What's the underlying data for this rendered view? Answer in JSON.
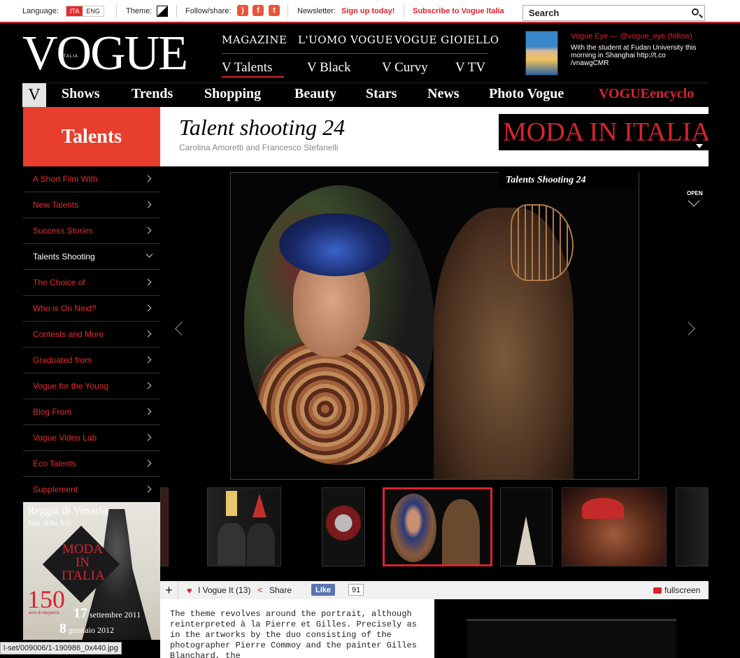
{
  "topbar": {
    "language_label": "Language:",
    "lang_ita": "ITA",
    "lang_eng": "ENG",
    "theme_label": "Theme:",
    "follow_label": "Follow/share:",
    "newsletter_label": "Newsletter:",
    "signup": "Sign up today!",
    "subscribe": "Subscribe to Vogue Italia",
    "search_placeholder": "Search",
    "social_icons": [
      "rss-icon",
      "facebook-icon",
      "twitter-icon"
    ]
  },
  "logo": {
    "text": "VOGUE",
    "sub": "ITALIA"
  },
  "topnav": {
    "row1": [
      "MAGAZINE",
      "L'UOMO VOGUE",
      "VOGUE GIOIELLO"
    ],
    "row2": [
      "V Talents",
      "V Black",
      "V Curvy",
      "V TV"
    ],
    "active": "V Talents"
  },
  "vogue_eye": {
    "title": "Vogue Eye — @vogue_eye (follow)",
    "text": "With the student at Fudan University this morning in Shanghai http://t.co /vnawgCMR"
  },
  "mainnav": {
    "v": "V",
    "items": [
      "Shows",
      "Trends",
      "Shopping",
      "Beauty",
      "Stars",
      "News",
      "Photo Vogue"
    ],
    "encyclo": "VOGUEencyclo"
  },
  "section": {
    "title": "Talents"
  },
  "article": {
    "title": "Talent shooting 24",
    "subtitle": "Carolina Amoretti and Francesco Stefanelli"
  },
  "banner": {
    "text": "MODA IN ITALIA"
  },
  "sidebar": {
    "items": [
      {
        "label": "A Short Film With",
        "current": false
      },
      {
        "label": "New Talents",
        "current": false
      },
      {
        "label": "Success Stories",
        "current": false
      },
      {
        "label": "Talents Shooting",
        "current": true
      },
      {
        "label": "The Choice of",
        "current": false
      },
      {
        "label": "Who is On Next?",
        "current": false
      },
      {
        "label": "Contests and More",
        "current": false
      },
      {
        "label": "Graduated from",
        "current": false
      },
      {
        "label": "Vogue for the Young",
        "current": false
      },
      {
        "label": "Blog From",
        "current": false
      },
      {
        "label": "Vogue Video Lab",
        "current": false
      },
      {
        "label": "Eco Talents",
        "current": false
      },
      {
        "label": "Supplement",
        "current": false
      }
    ]
  },
  "ad": {
    "line1": "Reggia di Venaria",
    "line2": "Sale delle Arti",
    "moda": "MODA IN ITALIA",
    "num": "150",
    "eleganza": "anni di eleganza",
    "date1_day": "17",
    "date1_rest": "settembre 2011",
    "date2_day": "8",
    "date2_rest": "gennaio 2012"
  },
  "gallery": {
    "caption": "Talents Shooting 24",
    "open_label": "OPEN",
    "selected_index": 4
  },
  "footerbar": {
    "i_vogue_it": "I Vogue It (13)",
    "share": "Share",
    "like": "Like",
    "like_count": "91",
    "fullscreen": "fullscreen"
  },
  "body": {
    "text": "The theme revolves around the portrait, although reinterpreted à la Pierre et Gilles. Precisely as in the artworks by the duo consisting of the photographer Pierre Commoy and the painter Gilles Blanchard, the"
  },
  "status": {
    "url": "l-set/009006/1-190986_0x440.jpg"
  }
}
